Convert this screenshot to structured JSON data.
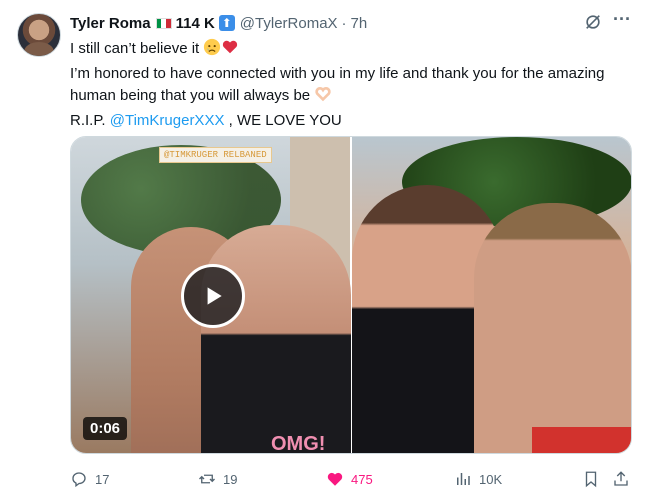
{
  "tweet": {
    "author_name": "Tyler Roma",
    "flag": "Italy",
    "followers": "114 K",
    "handle": "@TylerRomaX",
    "separator": "·",
    "time": "7h",
    "text": {
      "line1": "I still can’t believe it",
      "line1_emojis": [
        "sad-face",
        "red-heart"
      ],
      "line2": "I’m honored to have connected with you in my life and thank you for the amazing human being that you will always be",
      "line2_emoji": "heart-hands",
      "line3_prefix": "R.I.P.",
      "mention": "@TimKrugerXXX",
      "line3_suffix": ", WE LOVE YOU"
    },
    "media": {
      "video_overlay_label": "@TIMKRUGER RELBANED",
      "shirt_text": "OMG!",
      "duration": "0:06"
    },
    "stats": {
      "replies": "17",
      "reposts": "19",
      "likes": "475",
      "views": "10K"
    }
  },
  "colors": {
    "text": "#0f1419",
    "muted": "#536471",
    "link": "#1d9bf0",
    "like": "#f91880"
  },
  "icons": [
    "grok-icon",
    "more-icon",
    "reply-icon",
    "repost-icon",
    "like-icon",
    "views-icon",
    "bookmark-icon",
    "share-icon",
    "play-icon"
  ]
}
